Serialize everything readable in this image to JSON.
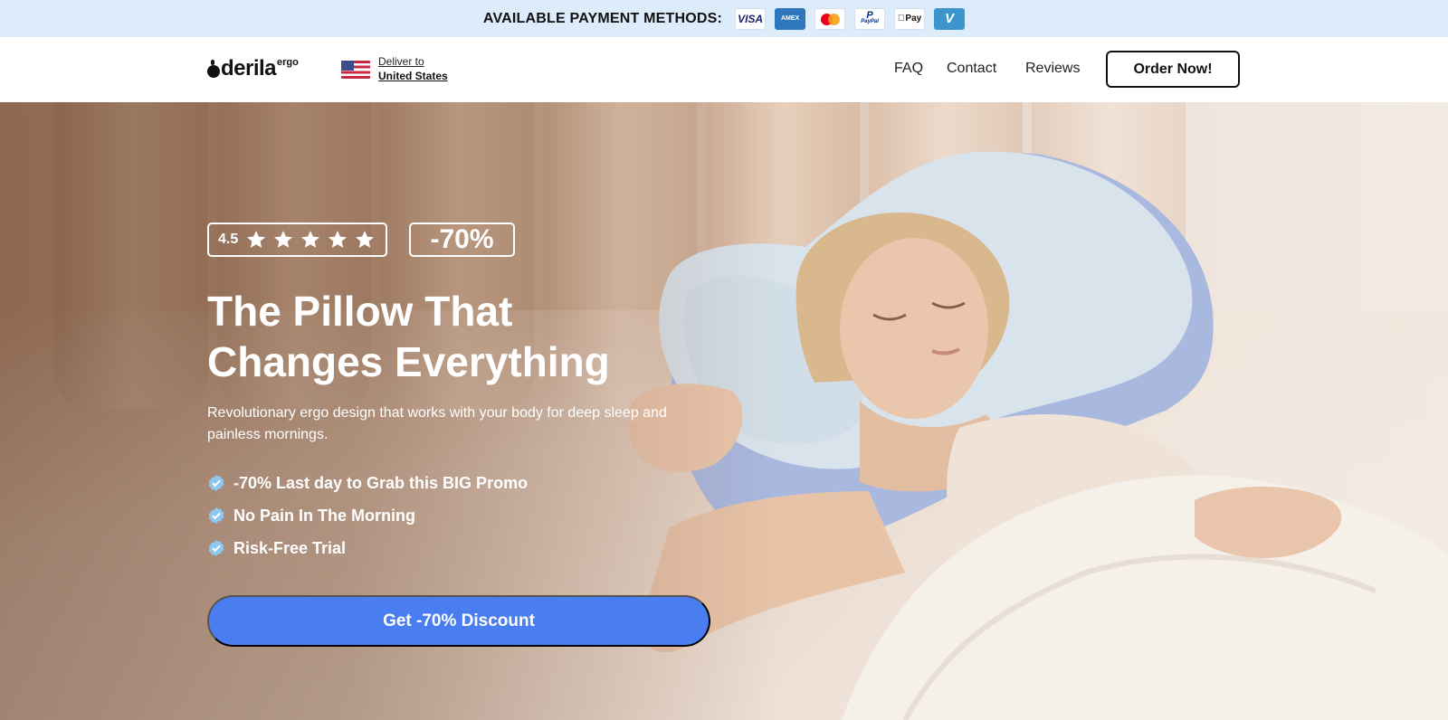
{
  "payment": {
    "title": "AVAILABLE PAYMENT METHODS:",
    "methods": [
      {
        "icon": "visa-icon",
        "label": "VISA",
        "color": "#1a1f71"
      },
      {
        "icon": "amex-icon",
        "label": "AMEX",
        "color": "#2e77bc"
      },
      {
        "icon": "mastercard-icon",
        "label": "",
        "color": "#eb001b"
      },
      {
        "icon": "paypal-icon",
        "label": "PayPal",
        "color": "#003087"
      },
      {
        "icon": "apple-pay-icon",
        "label": "Pay",
        "color": "#111111"
      },
      {
        "icon": "venmo-icon",
        "label": "V",
        "color": "#3d95ce"
      }
    ]
  },
  "header": {
    "logo_text": "derila",
    "logo_sup": "ergo",
    "deliver_label": "Deliver to",
    "deliver_country": "United States",
    "flag_icon": "us-flag-icon",
    "nav": [
      {
        "label": "FAQ"
      },
      {
        "label": "Contact"
      },
      {
        "label": "Reviews"
      }
    ],
    "order_button": "Order Now!"
  },
  "hero": {
    "rating": "4.5",
    "stars": 5,
    "discount_badge": "-70%",
    "headline_line1": "The Pillow That",
    "headline_line2": "Changes Everything",
    "subtext": "Revolutionary ergo design that works with your body for deep sleep and painless mornings.",
    "bullets": [
      {
        "icon": "check-badge-icon",
        "label": "-70% Last day to Grab this BIG Promo"
      },
      {
        "icon": "check-badge-icon",
        "label": "No Pain In The Morning"
      },
      {
        "icon": "check-badge-icon",
        "label": "Risk-Free Trial"
      }
    ],
    "cta_label": "Get -70% Discount"
  },
  "colors": {
    "payment_bar": "#dcecfb",
    "cta": "#4a7df0",
    "check": "#8ec8ef"
  }
}
